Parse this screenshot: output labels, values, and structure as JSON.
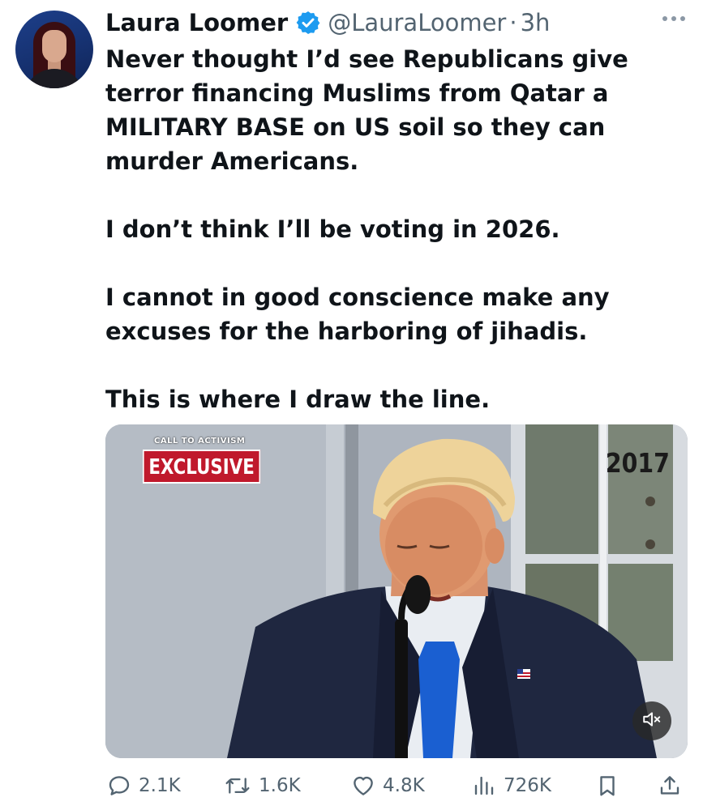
{
  "author": {
    "display_name": "Laura Loomer",
    "handle": "@LauraLoomer",
    "separator": "·",
    "time": "3h",
    "verified_color": "#1d9bf0"
  },
  "tweet": {
    "paragraphs": [
      "Never thought I’d see Republicans give terror financing Muslims from Qatar a MILITARY BASE on US soil so they can murder Americans.",
      "I don’t think I’ll be voting in 2026.",
      "I cannot in good conscience make any excuses for the harboring of jihadis.",
      "This is where I draw the line."
    ]
  },
  "media": {
    "type": "video",
    "overlay_small": "CALL TO ACTIVISM",
    "overlay_badge": "EXCLUSIVE",
    "overlay_year": "2017",
    "badge_color": "#c0192c",
    "muted": true
  },
  "actions": {
    "replies": "2.1K",
    "reposts": "1.6K",
    "likes": "4.8K",
    "views": "726K"
  },
  "icons": {
    "reply": "reply-icon",
    "repost": "repost-icon",
    "like": "heart-icon",
    "views": "views-icon",
    "bookmark": "bookmark-icon",
    "share": "share-icon",
    "more": "more-icon",
    "mute": "mute-icon",
    "verified": "verified-badge-icon"
  }
}
